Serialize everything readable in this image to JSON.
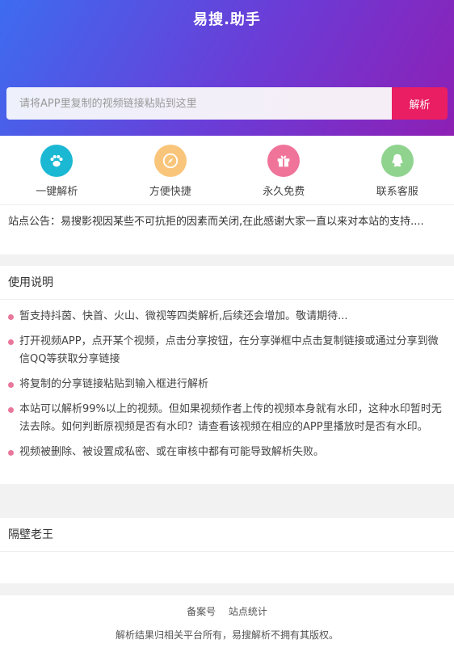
{
  "header": {
    "logo_text": "易搜.助手"
  },
  "search": {
    "placeholder": "请将APP里复制的视频链接粘贴到这里",
    "button_label": "解析"
  },
  "features": [
    {
      "label": "一键解析",
      "icon": "paw-icon",
      "color": "#1bb8d4"
    },
    {
      "label": "方便快捷",
      "icon": "compass-icon",
      "color": "#f9c57a"
    },
    {
      "label": "永久免费",
      "icon": "gift-icon",
      "color": "#f0749a"
    },
    {
      "label": "联系客服",
      "icon": "qq-icon",
      "color": "#8fd38f"
    }
  ],
  "notice": {
    "text": "站点公告：易搜影视因某些不可抗拒的因素而关闭,在此感谢大家一直以来对本站的支持...."
  },
  "usage": {
    "title": "使用说明",
    "items": [
      "暂支持抖茵、快首、火山、微视等四类解析,后续还会增加。敬请期待...",
      "打开视频APP，点开某个视频，点击分享按钮，在分享弹框中点击复制链接或通过分享到微信QQ等获取分享链接",
      "将复制的分享链接粘贴到输入框进行解析",
      "本站可以解析99%以上的视频。但如果视频作者上传的视频本身就有水印，这种水印暂时无法去除。如何判断原视频是否有水印？请查看该视频在相应的APP里播放时是否有水印。",
      "视频被删除、被设置成私密、或在审核中都有可能导致解析失败。"
    ]
  },
  "neighbor": {
    "title": "隔壁老王"
  },
  "footer": {
    "links": [
      "备案号",
      "站点统计"
    ],
    "copyright": "解析结果归相关平台所有，易搜解析不拥有其版权。"
  },
  "colors": {
    "accent": "#e91e63",
    "bullet": "#e8779a"
  }
}
